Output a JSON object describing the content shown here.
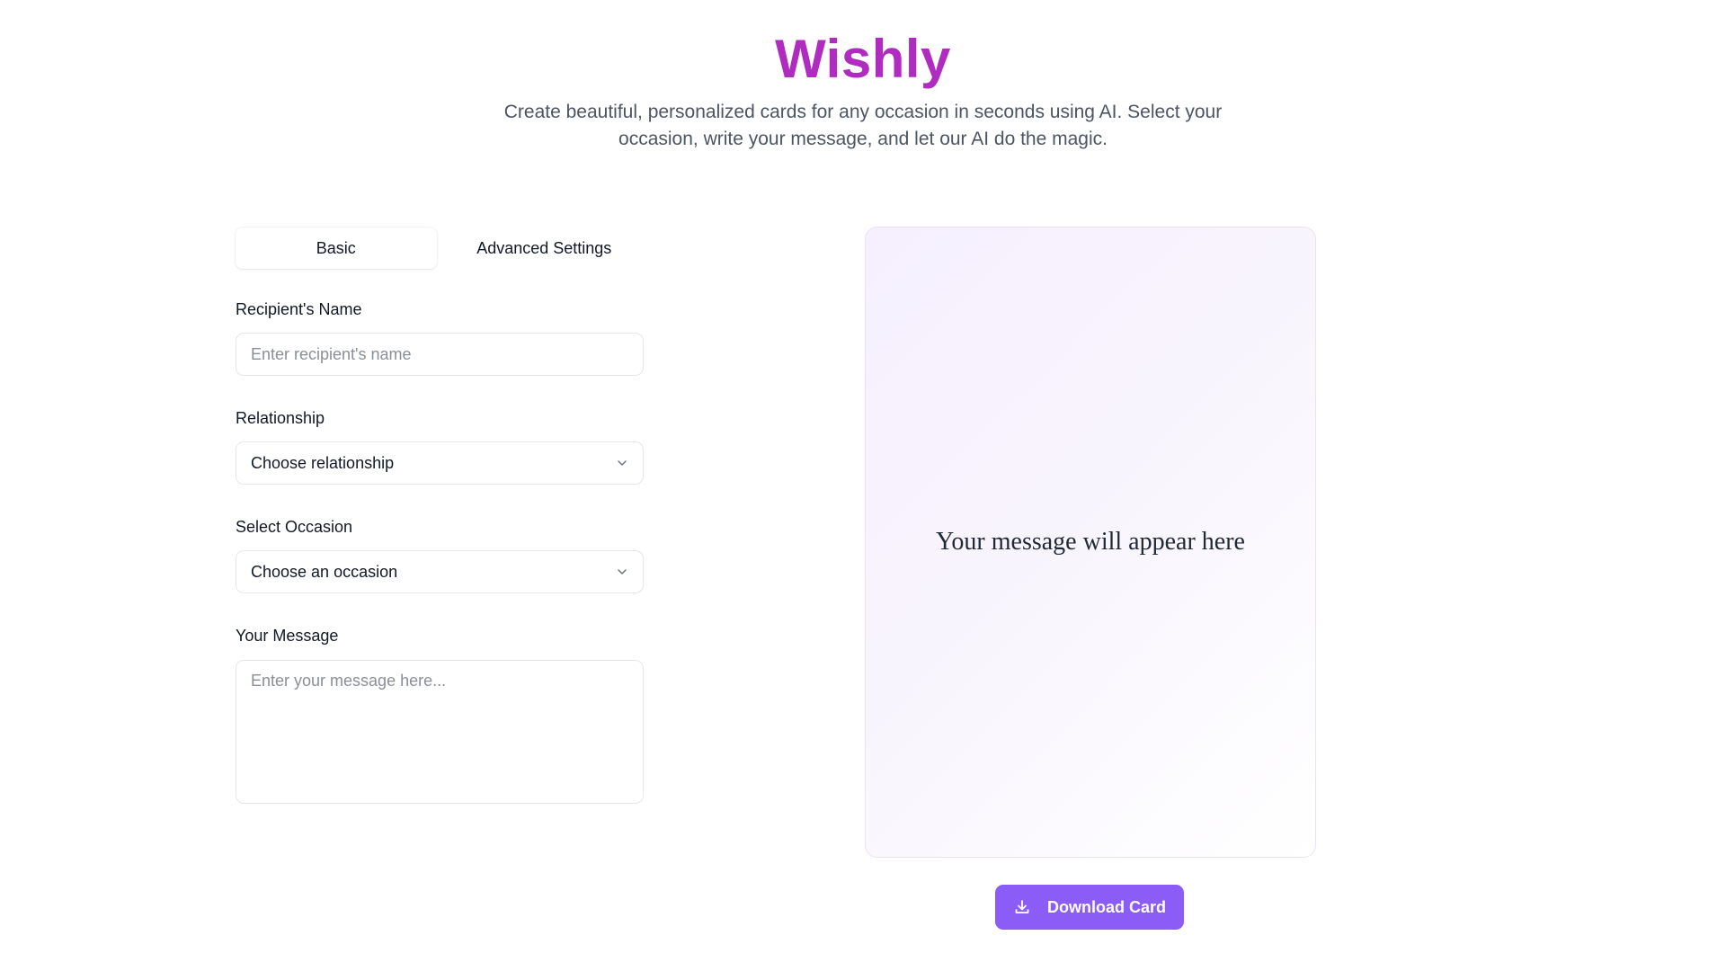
{
  "header": {
    "title": "Wishly",
    "subtitle": "Create beautiful, personalized cards for any occasion in seconds using AI. Select your occasion, write your message, and let our AI do the magic."
  },
  "tabs": [
    {
      "label": "Basic",
      "active": true
    },
    {
      "label": "Advanced Settings",
      "active": false
    }
  ],
  "form": {
    "recipient_name": {
      "label": "Recipient's Name",
      "placeholder": "Enter recipient's name",
      "value": ""
    },
    "relationship": {
      "label": "Relationship",
      "selected": "Choose relationship"
    },
    "occasion": {
      "label": "Select Occasion",
      "selected": "Choose an occasion"
    },
    "message": {
      "label": "Your Message",
      "placeholder": "Enter your message here...",
      "value": ""
    }
  },
  "preview": {
    "message": "Your message will appear here"
  },
  "actions": {
    "download_label": "Download Card"
  },
  "colors": {
    "brand": "#b02bc0",
    "button": "#8b5cf6",
    "subtitle": "#4b5563"
  },
  "icons": {
    "dropdown": "chevron-down-icon",
    "download": "download-icon"
  }
}
